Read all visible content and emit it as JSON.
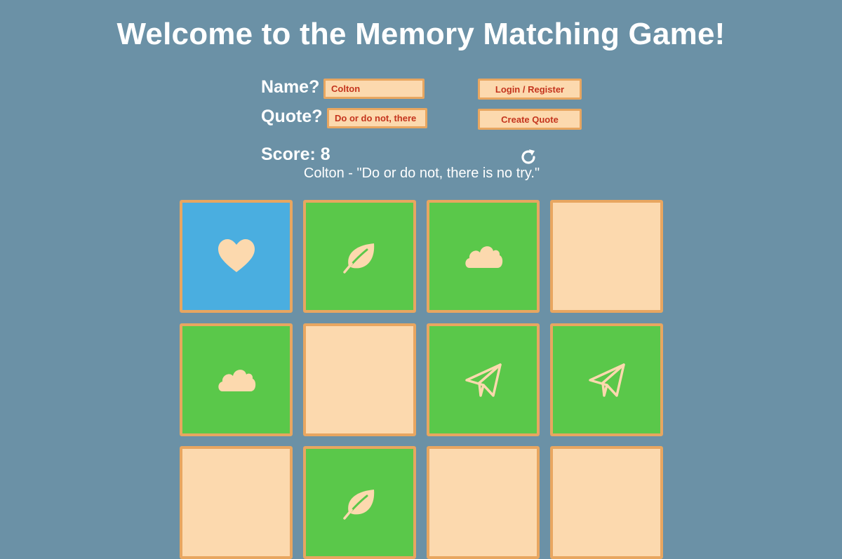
{
  "title": "Welcome to the Memory Matching Game!",
  "form": {
    "name_label": "Name?",
    "name_value": "Colton",
    "quote_label": "Quote?",
    "quote_value": "Do or do not, there",
    "login_button": "Login / Register",
    "create_quote_button": "Create Quote"
  },
  "score": {
    "text": "Score: 8",
    "refresh_icon": "refresh-icon"
  },
  "quote_display": "Colton - \"Do or do not, there is no try.\"",
  "colors": {
    "background": "#6b91a6",
    "card_back": "#fcd9ae",
    "card_border": "#e8a660",
    "matched": "#5ac84a",
    "open": "#4aaee0",
    "icon": "#fcd9ae",
    "field_text": "#c4341d"
  },
  "cards": [
    {
      "state": "open",
      "icon": "heart"
    },
    {
      "state": "matched",
      "icon": "leaf"
    },
    {
      "state": "matched",
      "icon": "cloud"
    },
    {
      "state": "hidden",
      "icon": ""
    },
    {
      "state": "matched",
      "icon": "cloud"
    },
    {
      "state": "hidden",
      "icon": ""
    },
    {
      "state": "matched",
      "icon": "paper-plane"
    },
    {
      "state": "matched",
      "icon": "paper-plane"
    },
    {
      "state": "hidden",
      "icon": ""
    },
    {
      "state": "matched",
      "icon": "leaf"
    },
    {
      "state": "hidden",
      "icon": ""
    },
    {
      "state": "hidden",
      "icon": ""
    }
  ]
}
